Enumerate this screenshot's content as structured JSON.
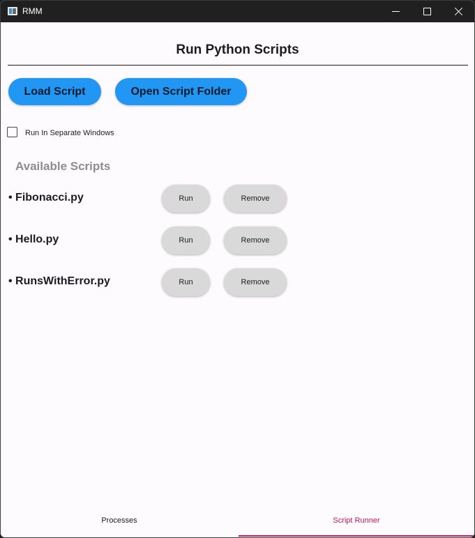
{
  "window": {
    "title": "RMM"
  },
  "main": {
    "title": "Run Python Scripts",
    "load_script_label": "Load Script",
    "open_folder_label": "Open Script Folder",
    "separate_windows_label": "Run In Separate Windows",
    "separate_windows_checked": false,
    "available_heading": "Available Scripts",
    "scripts": [
      {
        "name": "• Fibonacci.py",
        "run_label": "Run",
        "remove_label": "Remove"
      },
      {
        "name": "• Hello.py",
        "run_label": "Run",
        "remove_label": "Remove"
      },
      {
        "name": "• RunsWithError.py",
        "run_label": "Run",
        "remove_label": "Remove"
      }
    ]
  },
  "tabs": [
    {
      "label": "Processes",
      "active": false
    },
    {
      "label": "Script Runner",
      "active": true
    }
  ],
  "colors": {
    "primary_button": "#2196f3",
    "active_tab": "#c2185b",
    "secondary_button": "#d9d9d9",
    "titlebar": "#202020",
    "background": "#fefbff"
  }
}
